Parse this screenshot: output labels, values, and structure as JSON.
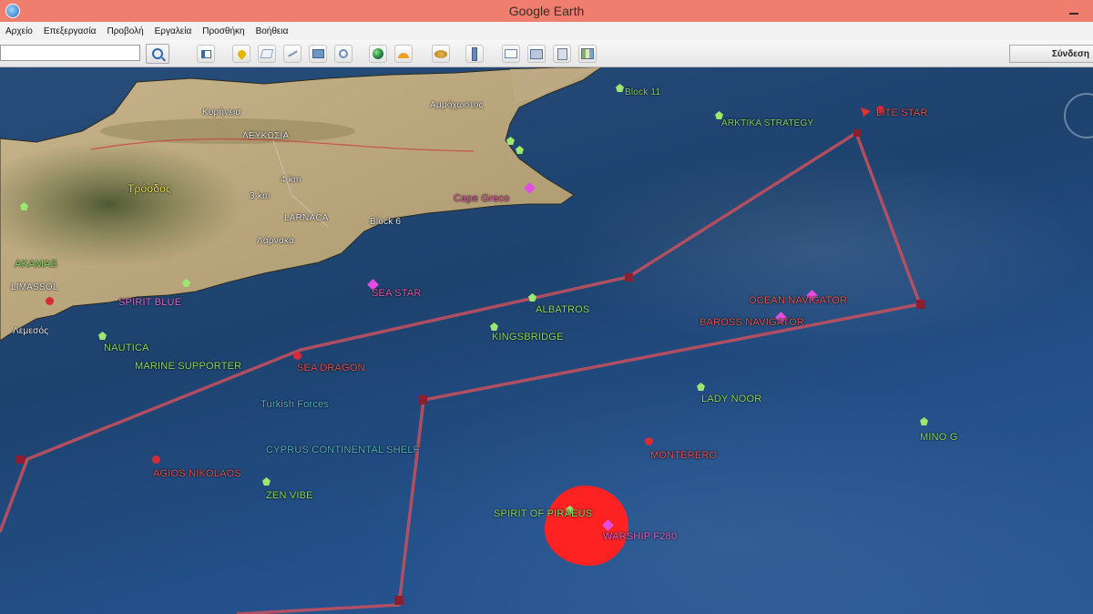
{
  "window": {
    "title": "Google Earth"
  },
  "menu": [
    "Αρχείο",
    "Επεξεργασία",
    "Προβολή",
    "Εργαλεία",
    "Προσθήκη",
    "Βοήθεια"
  ],
  "toolbar": {
    "search_value": "",
    "signin_label": "Σύνδεση",
    "buttons": [
      "sidebar-icon",
      "placemark-icon",
      "polygon-icon",
      "path-icon",
      "image-overlay-icon",
      "record-tour-icon",
      "earth-globe-icon",
      "sunlight-icon",
      "planets-icon",
      "ruler-icon",
      "email-icon",
      "print-icon",
      "save-image-icon",
      "google-maps-icon"
    ]
  },
  "map": {
    "places": {
      "kyrenia": "Κυρήνεια",
      "lefkosia": "ΛΕΥΚΩΣΙΑ",
      "troodos": "Τρόοδος",
      "larnaca": "LARNACA",
      "larnaka": "Λάρνακα",
      "ammochostos": "Αμμόχωστος",
      "cape_greco": "Cape Greco",
      "limassol": "LIMASSOL",
      "lemesos": "Λεμεσός"
    },
    "labels": {
      "zen_vibe": "ZEN VIBE",
      "spirit": "SPIRIT OF PIRAEUS",
      "warship": "WARSHIP F280",
      "monterero": "MONTERERO",
      "lady_noor": "LADY NOOR",
      "mino_g": "MINO G",
      "albatros": "ALBATROS",
      "kingsbridge": "KINGSBRIDGE",
      "sea_star": "SEA STAR",
      "sea_dragon": "SEA DRAGON",
      "nautica": "NAUTICA",
      "ocean_nav": "OCEAN NAVIGATOR",
      "baroness": "BAROSS NAVIGATOR",
      "agios": "AGIOS NIKOLAOS",
      "marine": "MARINE SUPPORTER",
      "spirit2": "SPIRIT BLUE",
      "akamas": "AKAMAS",
      "block_left": "Block 6",
      "cyan_a": "Turkish Forces",
      "cyan_b": "CYPRUS CONTINENTAL SHELF",
      "top_label1": "Block 11",
      "top_label2": "ARKTIKA STRATEGY",
      "lit1": "LITE STAR",
      "mid_label": "4 km",
      "dist": "3 km"
    }
  },
  "colors": {
    "titlebar": "#f07e6f",
    "route": "#c0505f",
    "zone": "#ff2222"
  }
}
